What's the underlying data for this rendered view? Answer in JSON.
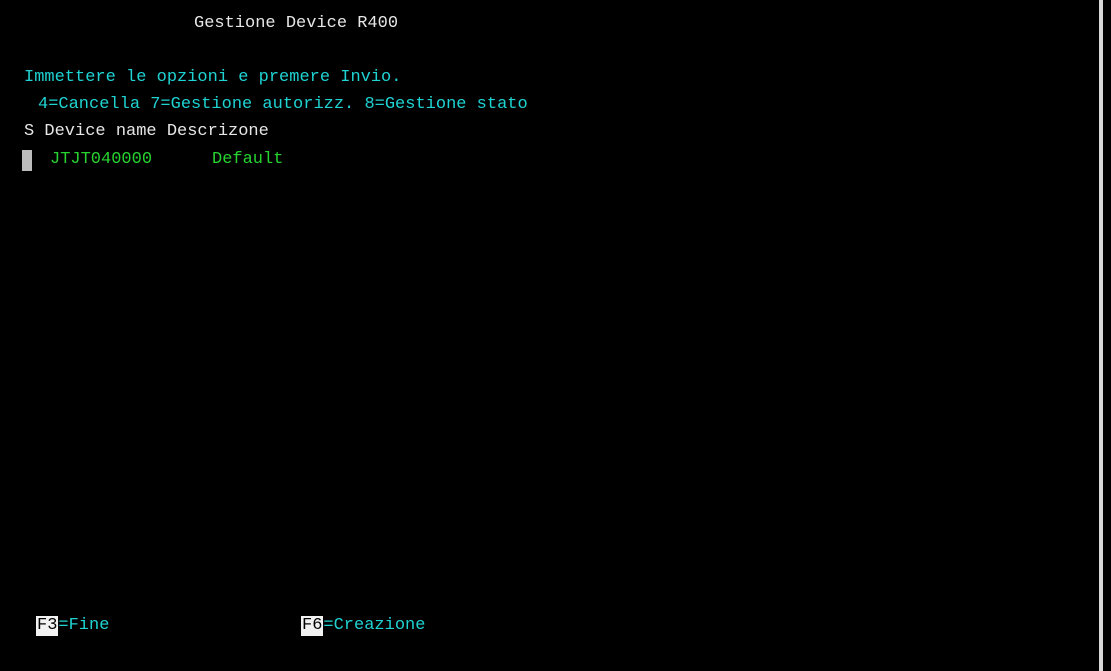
{
  "screen": {
    "title": "Gestione Device R400",
    "instructions": "Immettere le opzioni e premere Invio.",
    "options": "4=Cancella 7=Gestione autorizz. 8=Gestione stato"
  },
  "table": {
    "header": "S Device name Descrizone",
    "rows": [
      {
        "device_name": "JTJT040000",
        "description": "Default"
      }
    ]
  },
  "function_keys": [
    {
      "key": "F3",
      "label": "=Fine"
    },
    {
      "key": "F6",
      "label": "=Creazione"
    }
  ],
  "colors": {
    "background": "#000000",
    "white_text": "#e6e6e6",
    "cyan_text": "#1fd3d3",
    "green_text": "#27d42f"
  }
}
